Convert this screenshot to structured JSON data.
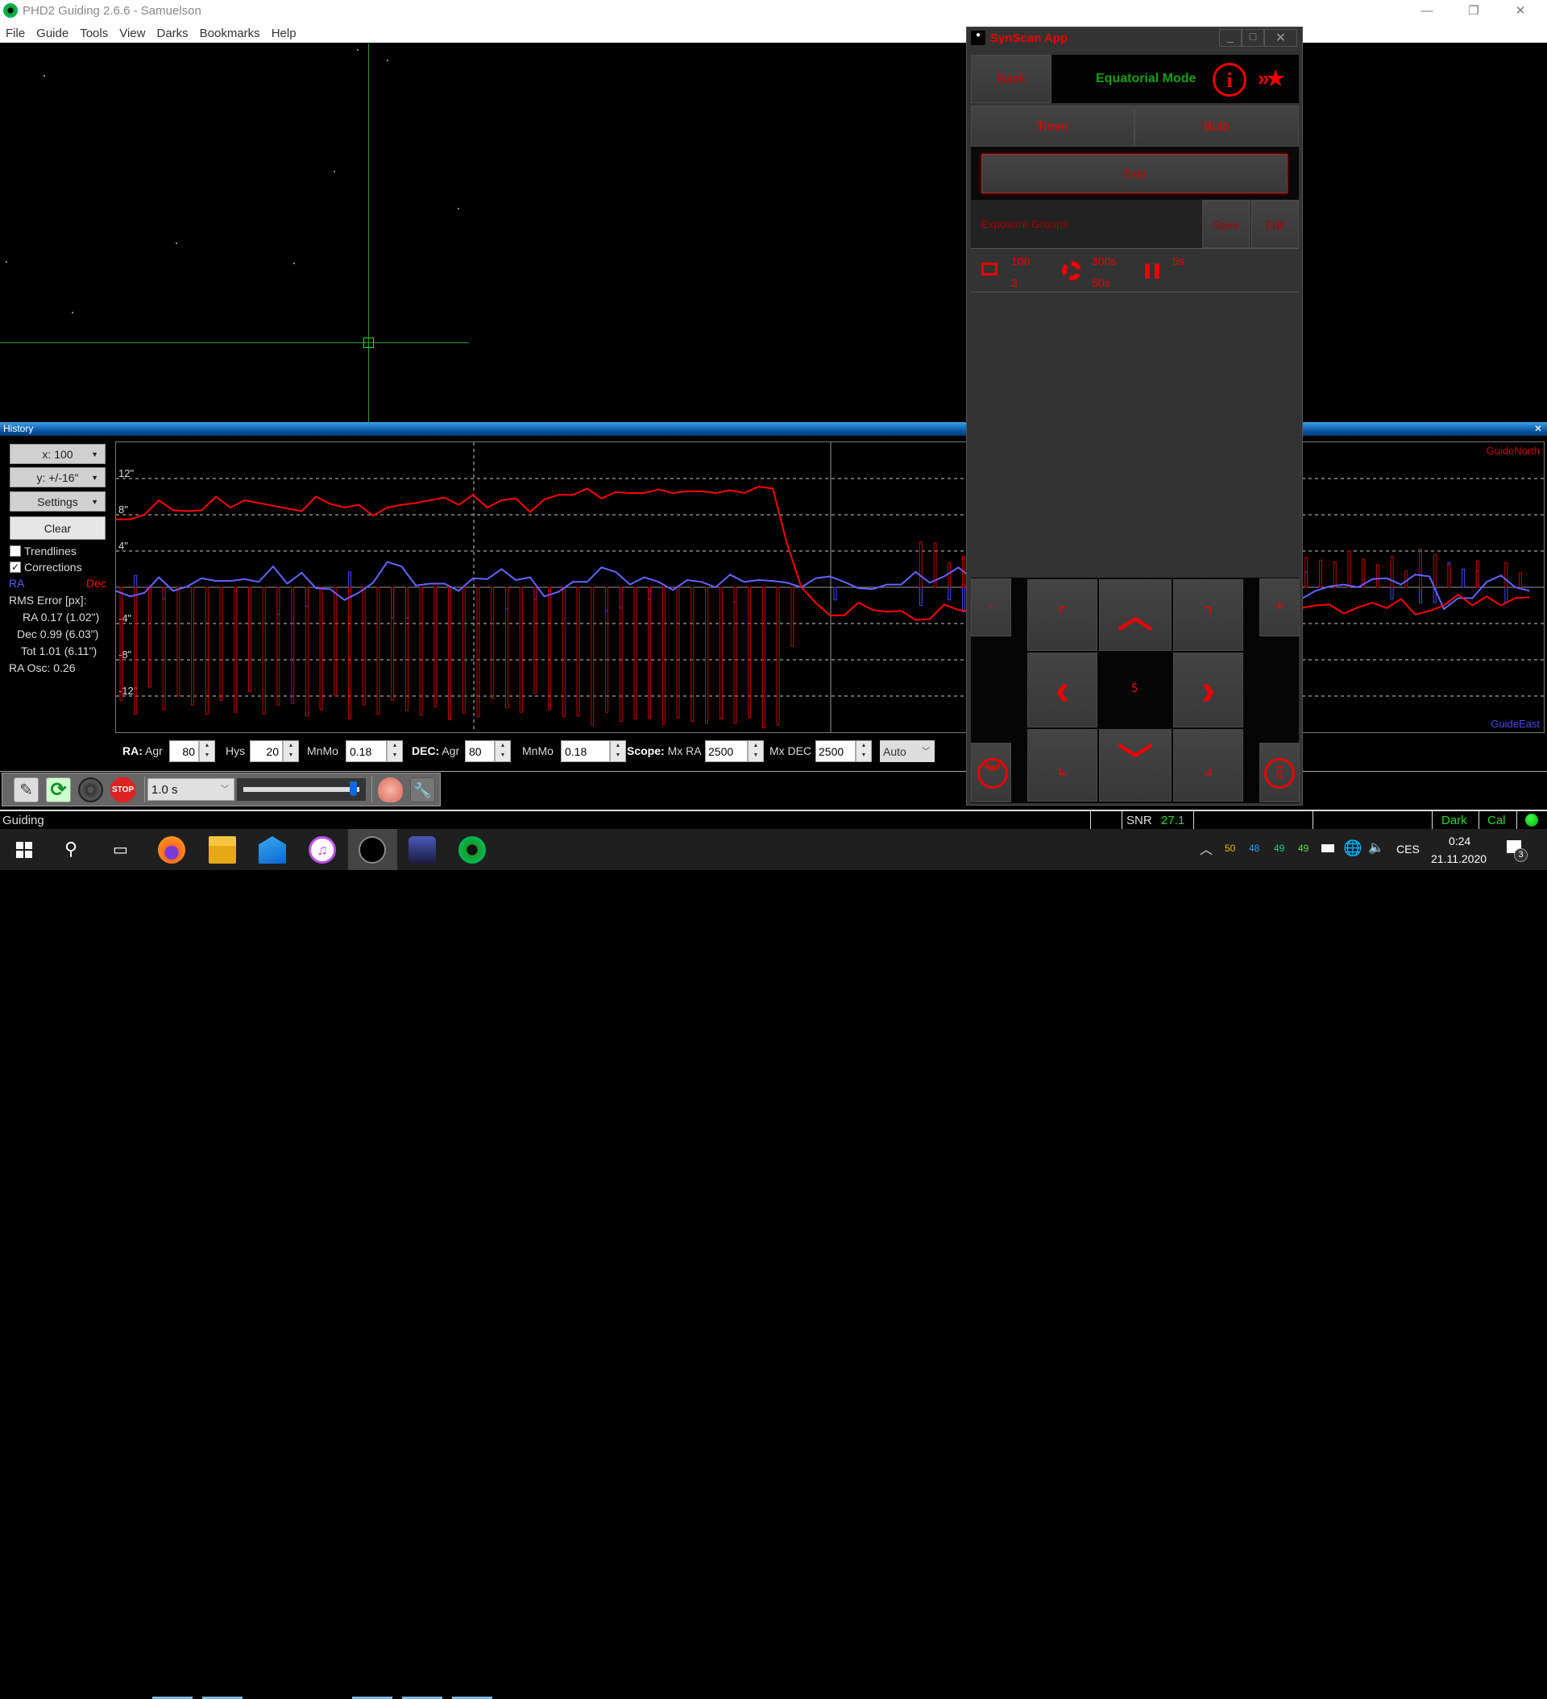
{
  "window": {
    "title": "PHD2 Guiding 2.6.6 - Samuelson",
    "menu": [
      "File",
      "Guide",
      "Tools",
      "View",
      "Darks",
      "Bookmarks",
      "Help"
    ]
  },
  "history": {
    "title": "History",
    "close": "✕",
    "x_select": "x: 100",
    "y_select": "y: +/-16\"",
    "settings": "Settings",
    "clear": "Clear",
    "trendlines": {
      "label": "Trendlines",
      "checked": false
    },
    "corrections": {
      "label": "Corrections",
      "checked": true
    },
    "ra_label": "RA",
    "dec_label": "Dec",
    "rms_title": "RMS Error [px]:",
    "rms_ra": "RA 0.17 (1.02\")",
    "rms_dec": "Dec 0.99 (6.03\")",
    "rms_tot": "Tot 1.01 (6.11\")",
    "ra_osc": "RA Osc: 0.26",
    "guide_north": "GuideNorth",
    "guide_east": "GuideEast"
  },
  "chart_data": {
    "type": "line",
    "ylim": [
      -16,
      16
    ],
    "x_points": 100,
    "grid": true,
    "y_ticks": [
      {
        "v": 12,
        "label": "12\""
      },
      {
        "v": 8,
        "label": "8\""
      },
      {
        "v": 4,
        "label": "4\""
      },
      {
        "v": -4,
        "label": "-4\""
      },
      {
        "v": -8,
        "label": "-8\""
      },
      {
        "v": -12,
        "label": "-12\""
      }
    ],
    "series": [
      {
        "name": "RA",
        "color": "#6464ff",
        "values": [
          -0.4,
          -1.0,
          -0.6,
          1.1,
          -0.4,
          0.1,
          1.0,
          0.7,
          0.7,
          0.9,
          0.6,
          2.3,
          0.4,
          1.6,
          -0.1,
          -0.2,
          -1.4,
          -0.6,
          0.5,
          2.8,
          2.3,
          0.2,
          0.4,
          0.4,
          -0.4,
          1.0,
          0.9,
          2.0,
          0.8,
          1.1,
          -1.0,
          -0.5,
          0.6,
          0.6,
          2.2,
          1.7,
          0.3,
          1.1,
          0.6,
          -0.3,
          0.8,
          0.6,
          0.0,
          1.4,
          0.6,
          0.8,
          0.7,
          0.5,
          0.0,
          1.0,
          1.2,
          0.6,
          -0.1,
          -0.2,
          0.3,
          0.3,
          1.7,
          0.5,
          1.2,
          2.2,
          0.9,
          null,
          null,
          null,
          null,
          null,
          null,
          null,
          null,
          null,
          null,
          null,
          null,
          null,
          null,
          null,
          null,
          null,
          null,
          null,
          null,
          null,
          null,
          -1.3,
          -0.4,
          0.1,
          0.3,
          0.0,
          0.9,
          1.0,
          0.3,
          1.4,
          1.2,
          -2.4,
          -1.2,
          -1.2,
          0.6,
          1.3,
          0.0,
          -0.4
        ]
      },
      {
        "name": "Dec",
        "color": "#ff0000",
        "values": [
          7.5,
          7.5,
          8.0,
          9.6,
          8.5,
          8.4,
          8.5,
          10.0,
          8.8,
          9.6,
          9.3,
          9.0,
          8.7,
          8.4,
          10.0,
          9.2,
          8.8,
          9.1,
          7.9,
          8.8,
          9.1,
          9.3,
          9.6,
          9.9,
          9.1,
          10.2,
          8.8,
          9.6,
          9.8,
          8.3,
          9.7,
          10.2,
          10.2,
          10.9,
          9.8,
          10.5,
          10.4,
          10.4,
          10.8,
          10.4,
          10.6,
          10.6,
          10.4,
          10.7,
          10.4,
          11.1,
          10.9,
          4.8,
          0.0,
          -1.7,
          -3.1,
          -3.1,
          -1.7,
          -2.5,
          -2.7,
          -2.6,
          -3.6,
          -3.5,
          -1.9,
          -2.5,
          -2.7,
          null,
          null,
          null,
          null,
          null,
          null,
          null,
          null,
          null,
          null,
          null,
          null,
          null,
          null,
          null,
          null,
          null,
          null,
          null,
          null,
          null,
          null,
          -2.3,
          -2.0,
          -1.9,
          -2.9,
          -2.2,
          -1.7,
          -2.3,
          -1.3,
          -3.0,
          -2.6,
          -2.0,
          -0.8,
          -2.0,
          -1.0,
          -2.0,
          -1.2,
          -1.1
        ]
      }
    ],
    "corrections": [
      {
        "name": "RA",
        "color": "#4848ff",
        "values": {
          "1": 1.3,
          "3": -1.3,
          "11": -3.0,
          "13": -2.1,
          "16": 1.7,
          "19": -3.4,
          "20": -3.4,
          "27": -2.4,
          "29": -1.3,
          "34": -2.6,
          "35": -2.3,
          "37": -1.3,
          "43": -1.6,
          "50": -1.4,
          "56": -2.0,
          "58": -1.4,
          "59": -2.7,
          "83": 1.7,
          "89": -1.3,
          "91": -1.7,
          "92": -1.7,
          "93": 2.7,
          "94": 2.0,
          "95": 1.8,
          "97": -1.7
        }
      },
      {
        "name": "Dec",
        "color": "#c80000",
        "values": {
          "0": -12.5,
          "1": -14,
          "2": -11,
          "3": -13.5,
          "4": -12,
          "5": -13,
          "6": -14,
          "7": -12.5,
          "8": -13.8,
          "9": -11.5,
          "10": -14,
          "11": -13,
          "12": -12.8,
          "13": -14.2,
          "14": -13.5,
          "15": -12,
          "16": -14.5,
          "17": -13,
          "18": -14,
          "19": -12.5,
          "20": -13.6,
          "21": -14.1,
          "22": -13.2,
          "23": -14.6,
          "24": -13.9,
          "25": -14.3,
          "26": -12.3,
          "27": -13.3,
          "28": -13.8,
          "29": -11.7,
          "30": -13.5,
          "31": -14.3,
          "32": -14.2,
          "33": -15.2,
          "34": -13.8,
          "35": -14.8,
          "36": -14.5,
          "37": -14.4,
          "38": -15.1,
          "39": -14.4,
          "40": -14.8,
          "41": -15.0,
          "42": -14.5,
          "43": -15.0,
          "44": -14.4,
          "45": -15.5,
          "46": -15.2,
          "47": -6.5,
          "56": 5.0,
          "57": 4.9,
          "58": 2.7,
          "59": 3.4,
          "83": 3.3,
          "84": 3.0,
          "85": 2.8,
          "86": 4.0,
          "87": 3.1,
          "88": 2.5,
          "89": 3.4,
          "90": 1.8,
          "91": 4.2,
          "92": 3.6,
          "93": 2.5,
          "95": 2.9,
          "97": 2.7,
          "98": 1.6
        }
      }
    ]
  },
  "params": {
    "ra_label": "RA:",
    "agr": "Agr",
    "ra_agr": "80",
    "hys": "Hys",
    "ra_hys": "20",
    "mnmo": "MnMo",
    "ra_mnmo": "0.18",
    "dec_label": "DEC:",
    "dec_agr": "80",
    "dec_mnmo": "0.18",
    "scope_label": "Scope:",
    "mx_ra": "Mx RA",
    "mx_ra_val": "2500",
    "mx_dec": "Mx DEC",
    "mx_dec_val": "2500",
    "mode": "Auto"
  },
  "toolbar": {
    "exposure": "1.0 s",
    "gamma_level": 0.97
  },
  "status": {
    "text": "Guiding",
    "snr_label": "SNR",
    "snr_value": "27.1",
    "dark": "Dark",
    "cal": "Cal"
  },
  "synscan": {
    "title": "SynScan App",
    "back": "Back",
    "mode": "Equatorial Mode",
    "timer": "Timer",
    "bulb": "Bulb",
    "stop": "Stop",
    "exposure_groups": "Exposure Groups",
    "save": "Save",
    "edit": "Edit",
    "frames": "100",
    "groups": "3",
    "exposure": "300s",
    "exposure2": "50s",
    "pause": "5s",
    "minus": "-",
    "plus": "+",
    "rate": "5"
  },
  "taskbar": {
    "tray": [
      {
        "v": "50",
        "c": "#f0c000"
      },
      {
        "v": "48",
        "c": "#2aa0ff"
      },
      {
        "v": "49",
        "c": "#20d080"
      },
      {
        "v": "49",
        "c": "#60e040"
      }
    ],
    "lang": "CES",
    "time": "0:24",
    "date": "21.11.2020",
    "notifications": "3"
  },
  "colors": {
    "accent": "#e00000",
    "mode_green": "#14a014",
    "snr_green": "#22dd22"
  }
}
